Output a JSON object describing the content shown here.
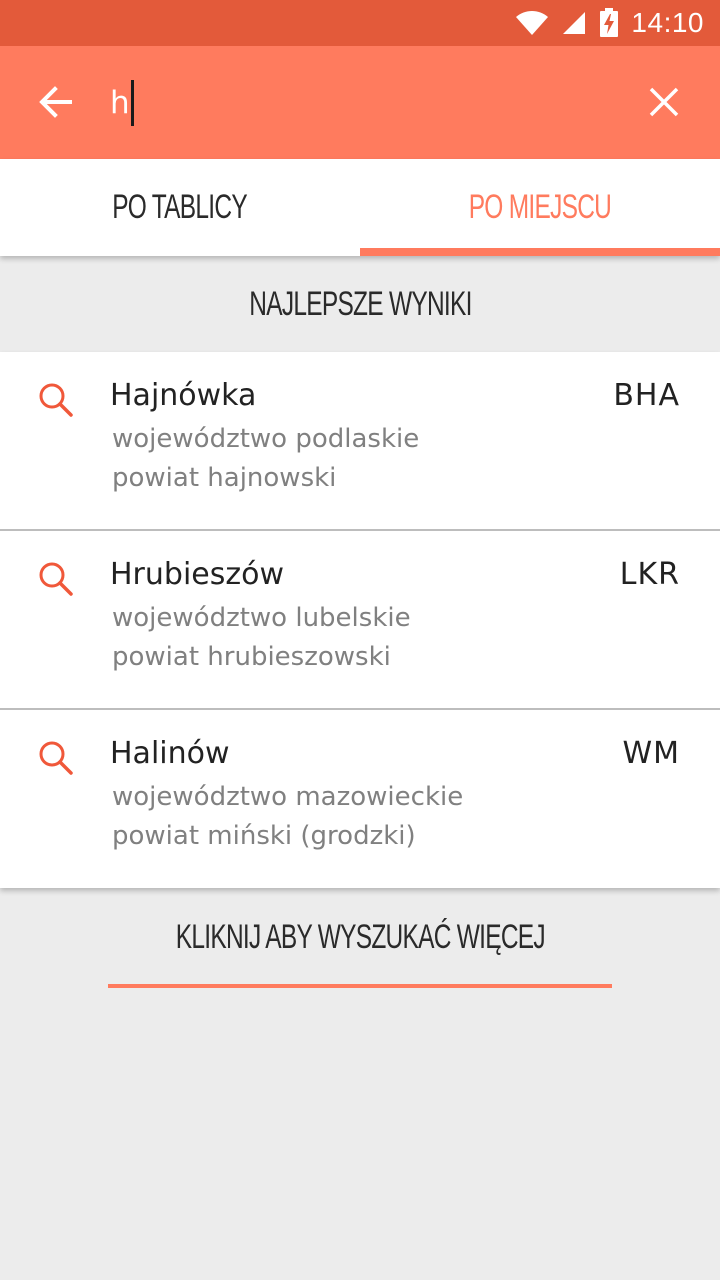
{
  "status_bar": {
    "time": "14:10",
    "icons": [
      "wifi-icon",
      "signal-icon",
      "battery-charging-icon"
    ]
  },
  "search": {
    "value": "h",
    "back_icon": "arrow-left-icon",
    "clear_icon": "close-icon"
  },
  "tabs": [
    {
      "label": "PO TABLICY",
      "selected": false
    },
    {
      "label": "PO MIEJSCU",
      "selected": true
    }
  ],
  "section_header": "NAJLEPSZE WYNIKI",
  "results": [
    {
      "name": "Hajnówka",
      "code": "BHA",
      "line1": "województwo podlaskie",
      "line2": "powiat hajnowski"
    },
    {
      "name": "Hrubieszów",
      "code": "LKR",
      "line1": "województwo lubelskie",
      "line2": "powiat hrubieszowski"
    },
    {
      "name": "Halinów",
      "code": "WM",
      "line1": "województwo mazowieckie",
      "line2": "powiat miński (grodzki)"
    }
  ],
  "more_label": "KLIKNIJ ABY WYSZUKAĆ WIĘCEJ",
  "colors": {
    "status_bar": "#e35a3a",
    "accent": "#ff7b5e",
    "background": "#ececec"
  }
}
